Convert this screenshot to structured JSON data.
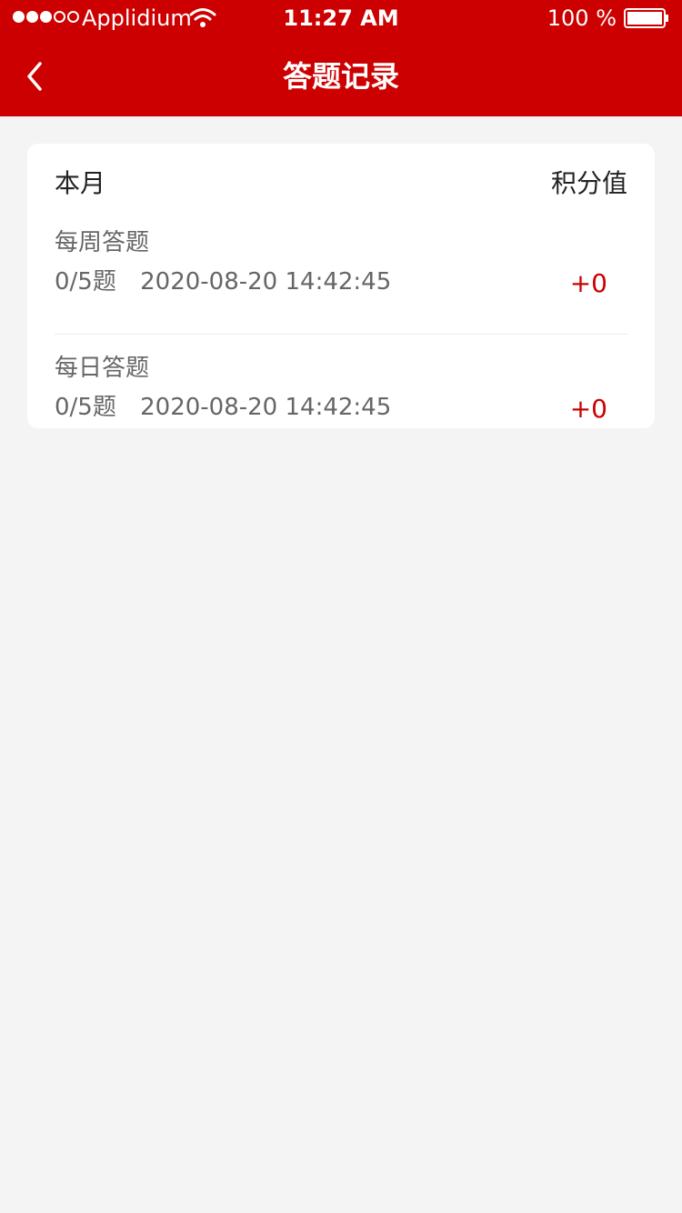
{
  "status_bar": {
    "carrier": "Applidium",
    "time": "11:27 AM",
    "battery": "100 %",
    "signal_filled": 3,
    "signal_total": 5
  },
  "nav": {
    "title": "答题记录",
    "back_icon": "chevron-left-icon"
  },
  "card": {
    "period_label": "本月",
    "points_label": "积分值",
    "records": [
      {
        "title": "每周答题",
        "count": "0/5题",
        "datetime": "2020-08-20 14:42:45",
        "points": "+0"
      },
      {
        "title": "每日答题",
        "count": "0/5题",
        "datetime": "2020-08-20 14:42:45",
        "points": "+0"
      }
    ]
  },
  "colors": {
    "accent": "#cc0000",
    "background": "#f4f4f4",
    "card": "#ffffff"
  }
}
